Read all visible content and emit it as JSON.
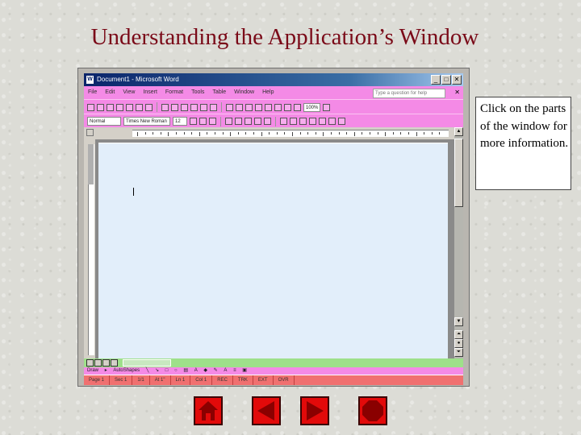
{
  "slide": {
    "title": "Understanding the Application’s Window",
    "note": "Click on the parts of the window for more information."
  },
  "window": {
    "title": "Document1 - Microsoft Word",
    "app_icon": "W",
    "controls": [
      "_",
      "□",
      "✕"
    ],
    "menu": [
      "File",
      "Edit",
      "View",
      "Insert",
      "Format",
      "Tools",
      "Table",
      "Window",
      "Help"
    ],
    "help_placeholder": "Type a question for help",
    "menu_close": "✕",
    "zoom": "100%",
    "style_value": "Normal",
    "font_value": "Times New Roman",
    "size_value": "12",
    "draw_label": "Draw",
    "autoshapes_label": "AutoShapes",
    "status": [
      "Page 1",
      "Sec 1",
      "1/1",
      "At 1\"",
      "Ln 1",
      "Col 1",
      "REC",
      "TRK",
      "EXT",
      "OVR"
    ]
  },
  "colors": {
    "title_text": "#7a0a18",
    "toolbar": "#f48ae6",
    "status": "#f07070",
    "scroll": "#9ee08a",
    "nav": "#e20a0a"
  },
  "nav": [
    "home-icon",
    "back-arrow-icon",
    "forward-arrow-icon",
    "stop-icon"
  ]
}
